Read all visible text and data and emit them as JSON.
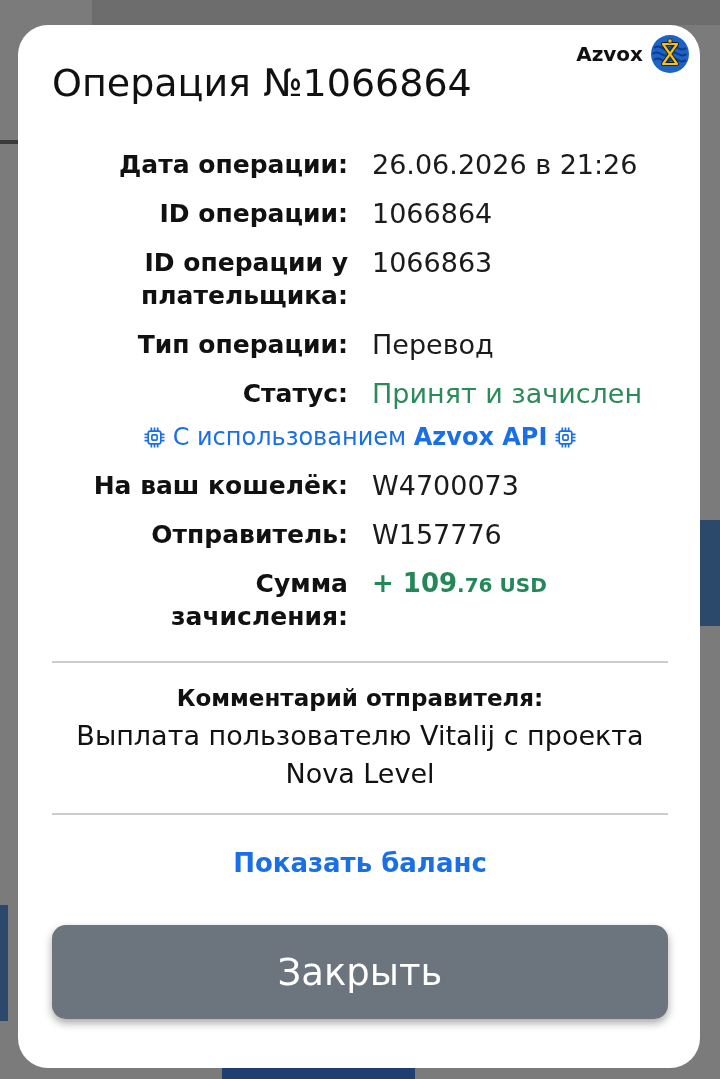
{
  "header": {
    "title": "Операция №1066864",
    "brand": "Azvox"
  },
  "details": [
    {
      "kind": "text",
      "label": "Дата операции:",
      "value": "26.06.2026 в 21:26"
    },
    {
      "kind": "text",
      "label": "ID операции:",
      "value": "1066864"
    },
    {
      "kind": "text",
      "label": "ID операции у плательщика:",
      "value": "1066863"
    },
    {
      "kind": "text",
      "label": "Тип операции:",
      "value": "Перевод"
    },
    {
      "kind": "status",
      "label": "Статус:",
      "value": "Принят и зачислен"
    },
    {
      "kind": "note",
      "text": "С использованием **Azvox API**"
    },
    {
      "kind": "text",
      "label": "На ваш кошелёк:",
      "value": "W4700073"
    },
    {
      "kind": "text",
      "label": "Отправитель:",
      "value": "W157776"
    },
    {
      "kind": "amount",
      "label": "Сумма зачисления:",
      "value": "+ 109",
      "value_minor": ".76 USD"
    }
  ],
  "comment": {
    "heading": "Комментарий отправителя:",
    "text": "Выплата пользователю Vitalij с проекта Nova Level"
  },
  "balance_link": "Показать баланс",
  "close_button": "Закрыть"
}
